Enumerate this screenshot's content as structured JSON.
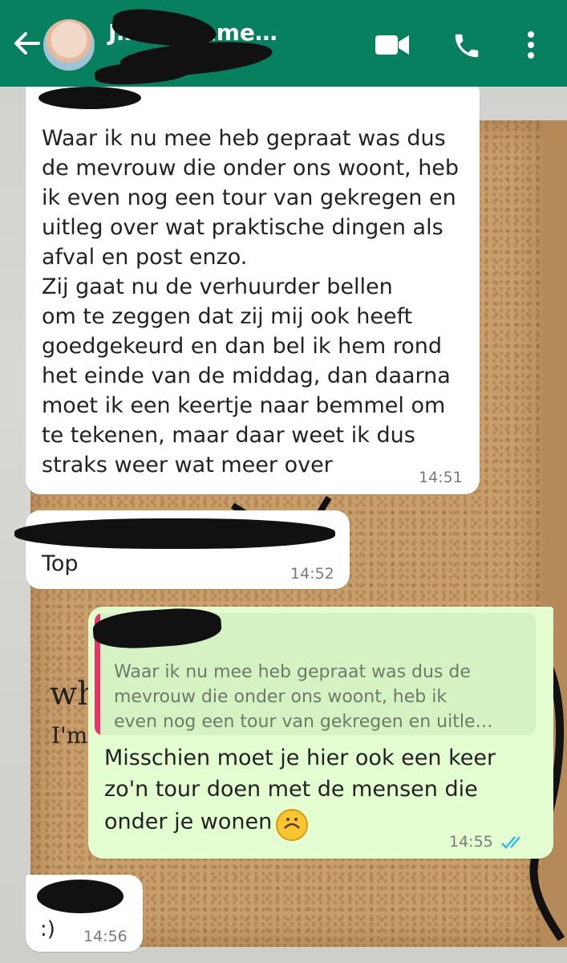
{
  "header": {
    "title_visible": "J… op kame…",
    "icons": [
      "back-arrow-icon",
      "video-call-icon",
      "phone-icon",
      "more-options-icon"
    ]
  },
  "messages": [
    {
      "direction": "incoming",
      "text": "Waar ik nu mee heb gepraat was dus\nde mevrouw die onder ons woont, heb\nik even nog een tour van gekregen en\nuitleg over wat praktische dingen als\nafval en post enzo.\nZij gaat nu de verhuurder bellen\nom te zeggen dat zij mij ook heeft\ngoedgekeurd en dan bel ik hem rond\nhet einde van de middag, dan daarna\nmoet ik een keertje naar bemmel om\nte tekenen, maar daar weet ik dus\nstraks weer wat meer over",
      "time": "14:51"
    },
    {
      "direction": "incoming",
      "text": "Top",
      "time": "14:52"
    },
    {
      "direction": "outgoing",
      "quote": "Waar ik nu mee heb gepraat was dus de\nmevrouw die onder ons woont, heb ik\neven nog een tour van gekregen en uitle…",
      "text_line1": "Misschien moet je hier ook een keer",
      "text_line2": "zo'n tour doen met de mensen die",
      "text_line3": "onder je wonen",
      "time": "14:55",
      "status": "read"
    },
    {
      "direction": "incoming",
      "text": ":)",
      "time": "14:56"
    }
  ],
  "colors": {
    "header": "#06805e",
    "incoming_bubble": "#ffffff",
    "outgoing_bubble": "#e3fdd0",
    "quote_bar": "#e8336b",
    "read_ticks": "#34b7f1"
  },
  "wallpaper": {
    "poster_text_1": "wh",
    "poster_text_2": "I'm"
  }
}
